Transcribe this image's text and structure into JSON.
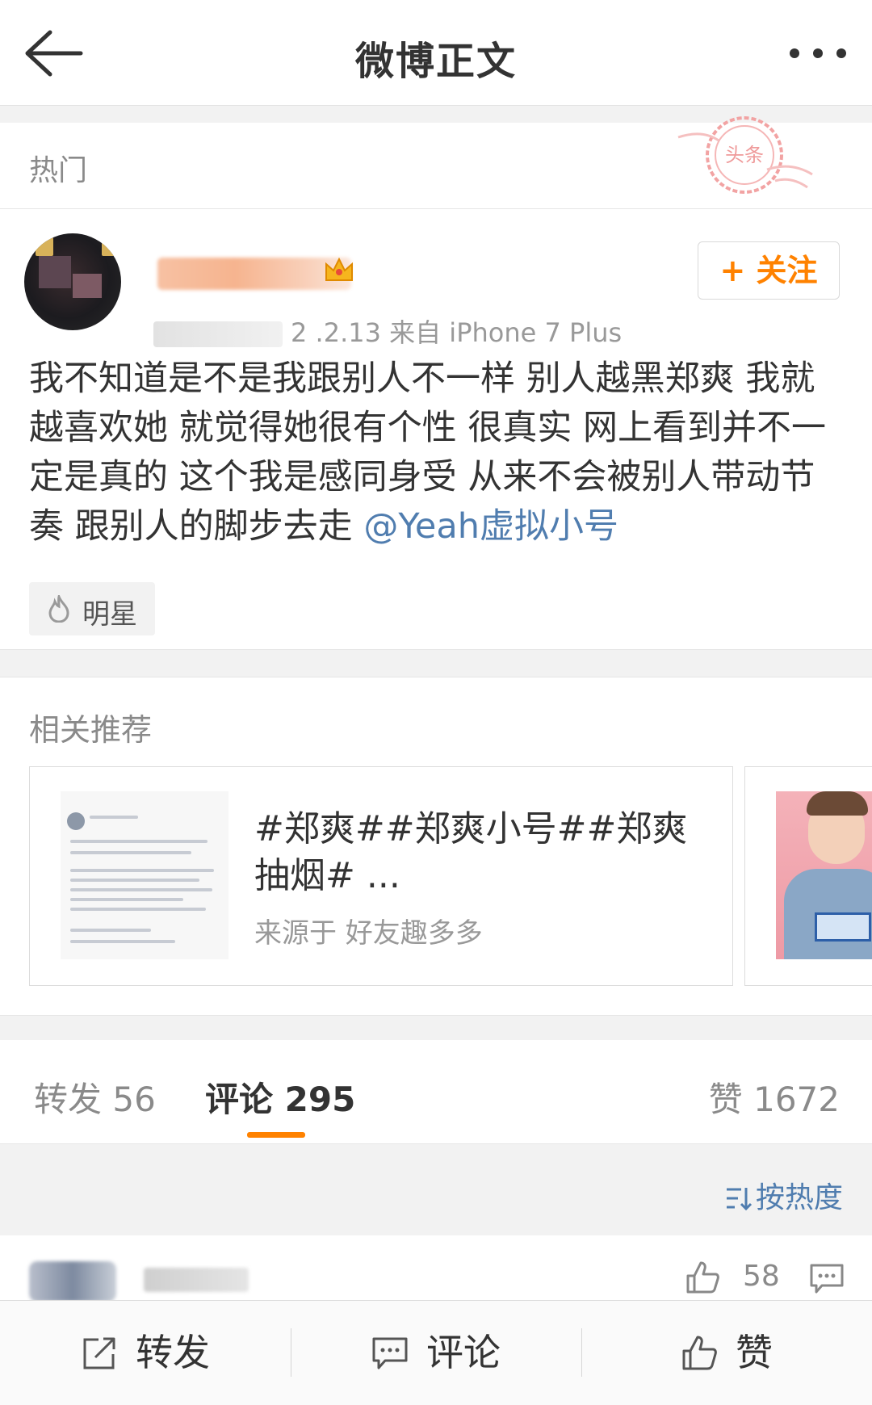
{
  "header": {
    "title": "微博正文",
    "back_icon": "arrow-left-icon",
    "more_icon": "more-dots-icon"
  },
  "hot_section": {
    "label": "热门",
    "stamp_text": "头条"
  },
  "post": {
    "meta": "2 .2.13  来自 iPhone 7 Plus",
    "follow_label": "+ 关注",
    "body_text": "我不知道是不是我跟别人不一样 别人越黑郑爽 我就越喜欢她 就觉得她很有个性 很真实 网上看到并不一定是真的 这个我是感同身受 从来不会被别人带动节奏 跟别人的脚步去走 ",
    "mention": "@Yeah虚拟小号",
    "tag_label": "明星",
    "accent_color": "#ff8200",
    "link_color": "#507daf"
  },
  "recommend": {
    "title": "相关推荐",
    "card": {
      "headline": "#郑爽##郑爽小号##郑爽抽烟# ...",
      "source": "来源于 好友趣多多"
    }
  },
  "tabs": {
    "repost": "转发 56",
    "comment": "评论 295",
    "like": "赞 1672"
  },
  "sort": {
    "label": "按热度"
  },
  "comment": {
    "like_count": "58"
  },
  "bottom_bar": {
    "repost": "转发",
    "comment": "评论",
    "like": "赞"
  }
}
